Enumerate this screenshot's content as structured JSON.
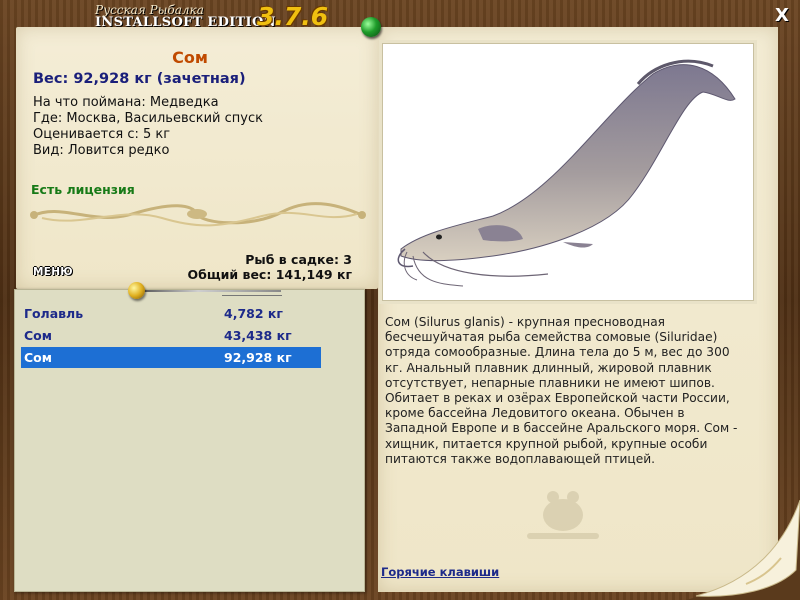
{
  "app": {
    "logo_line1": "Русская Рыбалка",
    "logo_line2": "INSTALLSOFT EDITION",
    "version": "3.7.6",
    "close_label": "X"
  },
  "fish": {
    "title": "Сом",
    "weight_line": "Вес: 92,928 кг (зачетная)",
    "caught_on": "На что поймана: Медведка",
    "location": "Где: Москва, Васильевский спуск",
    "rated_from": "Оценивается с: 5 кг",
    "kind": "Вид: Ловится редко",
    "license": "Есть лицензия",
    "description": "Сом (Silurus glanis) - крупная пресноводная бесчешуйчатая рыба семейства сомовые (Siluridae) отряда сомообразные. Длина тела до 5 м, вес до 300 кг. Анальный плавник длинный, жировой плавник отсутствует, непарные плавники не имеют шипов. Обитает в реках и озёрах Европейской части России, кроме бассейна Ледовитого океана. Обычен в Западной Европе и в бассейне Аральского моря. Сом - хищник, питается крупной рыбой, крупные особи питаются также водоплавающей птицей."
  },
  "menu_label": "МЕНЮ",
  "keepnet": {
    "count_line": "Рыб в садке: 3",
    "total_line": "Общий вес: 141,149 кг"
  },
  "catch_list": [
    {
      "name": "Голавль",
      "weight": "4,782 кг",
      "selected": false
    },
    {
      "name": "Сом",
      "weight": "43,438 кг",
      "selected": false
    },
    {
      "name": "Сом",
      "weight": "92,928 кг",
      "selected": true
    }
  ],
  "hotkeys_label": "Горячие клавиши",
  "colors": {
    "title": "#c04a00",
    "accent_text": "#1a1f7a",
    "license": "#177a17",
    "selection": "#1d6fd4"
  }
}
